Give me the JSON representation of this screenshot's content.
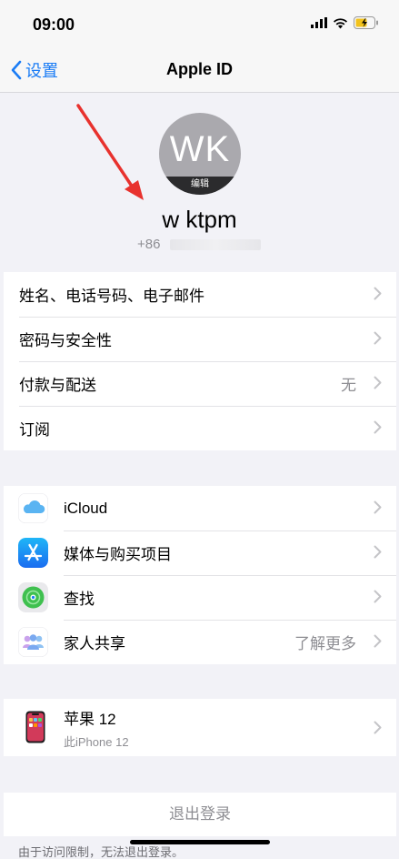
{
  "status_bar": {
    "time": "09:00"
  },
  "nav": {
    "back_label": "设置",
    "title": "Apple ID"
  },
  "profile": {
    "initials": "WK",
    "edit_label": "编辑",
    "name": "w ktpm",
    "phone_prefix": "+86"
  },
  "account_group": {
    "items": [
      {
        "label": "姓名、电话号码、电子邮件",
        "detail": ""
      },
      {
        "label": "密码与安全性",
        "detail": ""
      },
      {
        "label": "付款与配送",
        "detail": "无"
      },
      {
        "label": "订阅",
        "detail": ""
      }
    ]
  },
  "services_group": {
    "items": [
      {
        "label": "iCloud",
        "icon": "icloud-icon",
        "detail": ""
      },
      {
        "label": "媒体与购买项目",
        "icon": "app-store-icon",
        "detail": ""
      },
      {
        "label": "查找",
        "icon": "find-my-icon",
        "detail": ""
      },
      {
        "label": "家人共享",
        "icon": "family-sharing-icon",
        "detail": "了解更多"
      }
    ]
  },
  "devices_group": {
    "device_name": "苹果 12",
    "device_subtitle": "此iPhone 12",
    "icon": "iphone-icon"
  },
  "signout": {
    "label": "退出登录"
  },
  "footnote": "由于访问限制，无法退出登录。",
  "colors": {
    "accent": "#1a7cf5",
    "annotation_arrow": "#e8322e"
  }
}
